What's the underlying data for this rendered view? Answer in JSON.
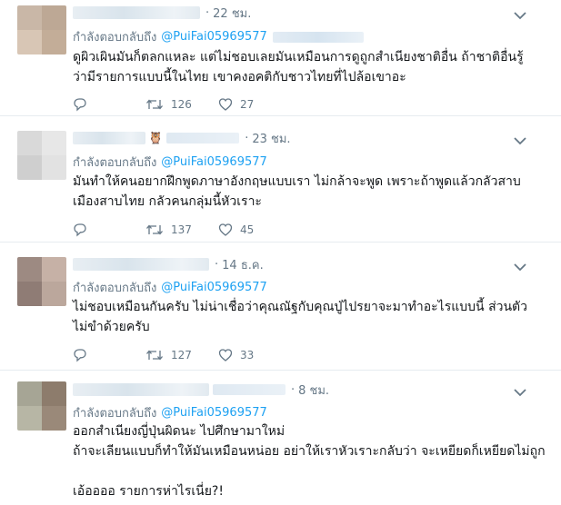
{
  "replying_label": "กำลังตอบกลับถึง",
  "mention": "@PuiFai05969577",
  "tweets": [
    {
      "time": "22 ชม.",
      "text": "ดูผิวเผินมันก็ตลกแหละ แต่ไม่ชอบเลยมันเหมือนการดูถูกสำเนียงชาติอื่น ถ้าชาติอื่นรู้ว่ามีรายการแบบนี้ในไทย เขาคงอคติกับชาวไทยที่ไปล้อเขาอะ",
      "retweets": "",
      "likes": "27",
      "avatar_colors": [
        "#c9b7a7",
        "#bda895",
        "#d8c6b5",
        "#c3ad98"
      ]
    },
    {
      "time": "23 ชม.",
      "text": "มันทำให้คนอยากฝึกพูดภาษาอังกฤษแบบเรา ไม่กล้าจะพูด เพราะถ้าพูดแล้วกลัวสาบเมืองสาบไทย กลัวคนกลุ่มนี้หัวเราะ",
      "retweets": "137",
      "likes": "45",
      "avatar_colors": [
        "#d9d9d9",
        "#e7e7e7",
        "#cfcfcf",
        "#e2e2e2"
      ]
    },
    {
      "time": "14 ธ.ค.",
      "text": "ไม่ชอบเหมือนกันครับ ไม่น่าเชื่อว่าคุณณัฐกับคุณปู่ไปรยาจะมาทำอะไรแบบนี้ ส่วนตัวไม่ขำด้วยครับ",
      "retweets": "127",
      "likes": "33",
      "avatar_colors": [
        "#9d8a82",
        "#c6b1a6",
        "#8f7c75",
        "#bba79c"
      ]
    },
    {
      "time": "8 ชม.",
      "text": "ออกสำเนียงญี่ปุ่นผิดนะ ไปศึกษามาใหม่\nถ้าจะเลียนแบบก็ทำให้มันเหมือนหน่อย อย่าให้เราหัวเราะกลับว่า จะเหยียดก็เหยียดไม่ถูก\n\nเอ้ออออ รายการห่าไรเนี่ย?!",
      "retweets": "",
      "likes": "",
      "avatar_colors": [
        "#a6a595",
        "#8d7c6c",
        "#b7b6a5",
        "#9a8979"
      ]
    }
  ],
  "colors": {
    "accent": "#1da1f2",
    "muted": "#657786",
    "divider": "#e6ecf0"
  },
  "icons": [
    "reply-icon",
    "retweet-icon",
    "like-icon",
    "caret-down-icon",
    "owl-emoji"
  ]
}
